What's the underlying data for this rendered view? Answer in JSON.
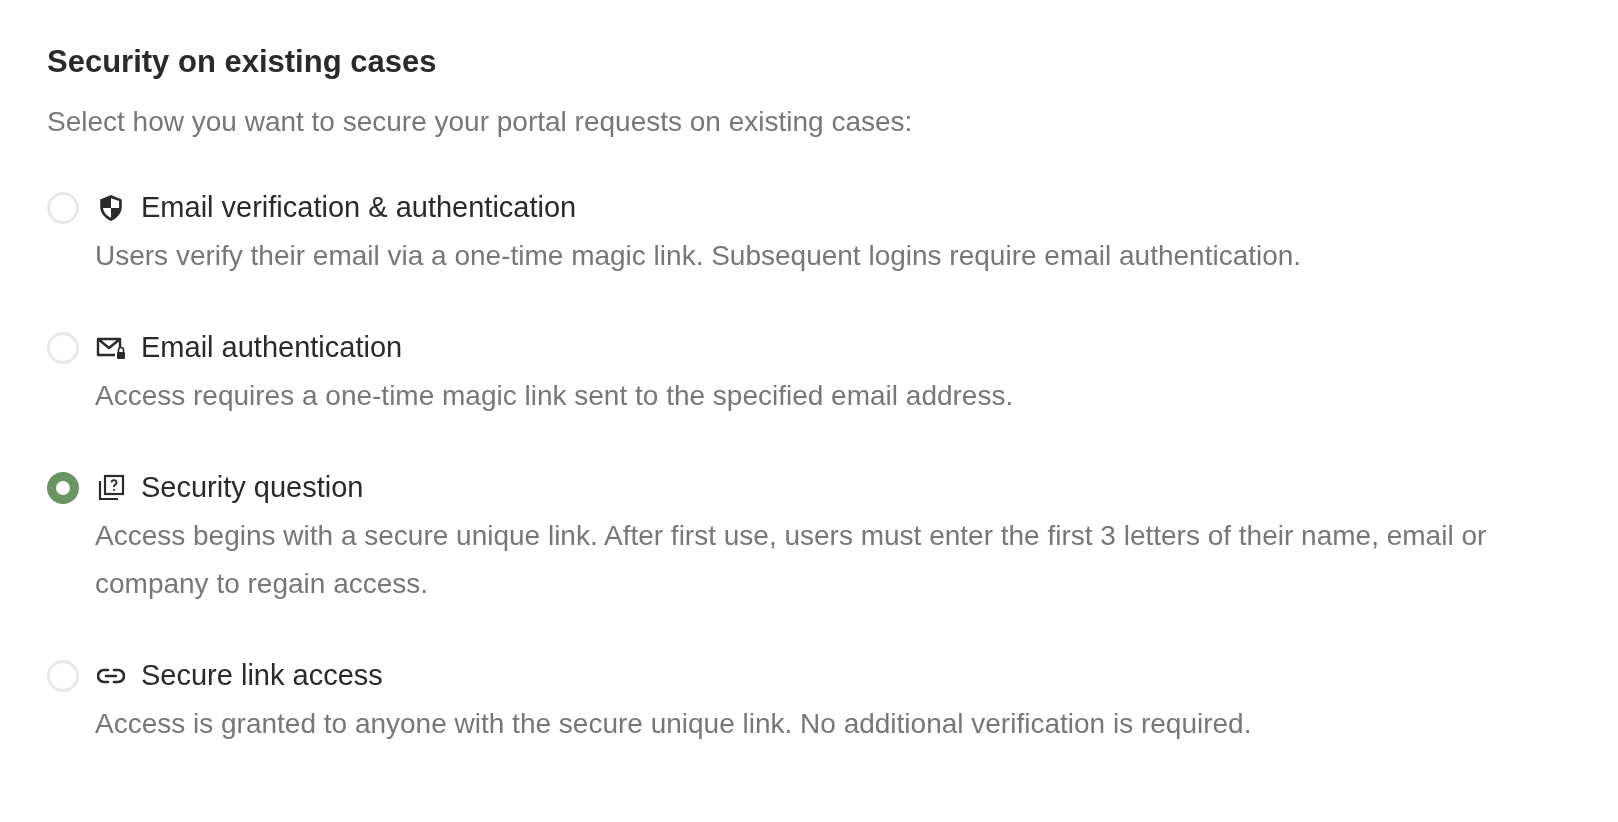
{
  "heading": "Security on existing cases",
  "subheading": "Select how you want to secure your portal requests on existing cases:",
  "options": [
    {
      "kind": "shield",
      "label": "Email verification & authentication",
      "description": "Users verify their email via a one-time magic link. Subsequent logins require email authentication.",
      "selected": false
    },
    {
      "kind": "mail",
      "label": "Email authentication",
      "description": "Access requires a one-time magic link sent to the specified email address.",
      "selected": false
    },
    {
      "kind": "question",
      "label": "Security question",
      "description": "Access begins with a secure unique link. After first use, users must enter the first 3 letters of their name, email or company to regain access.",
      "selected": true
    },
    {
      "kind": "link",
      "label": "Secure link access",
      "description": "Access is granted to anyone with the secure unique link. No additional verification is required.",
      "selected": false
    }
  ]
}
